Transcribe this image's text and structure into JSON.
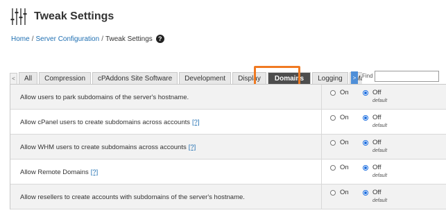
{
  "header": {
    "title": "Tweak Settings",
    "logo_icon": "sliders-icon"
  },
  "breadcrumb": {
    "items": [
      "Home",
      "Server Configuration",
      "Tweak Settings"
    ],
    "separator": "/",
    "help_icon": "question-circle-icon"
  },
  "tabs": {
    "scroll_left": "<",
    "scroll_right": ">",
    "items": [
      {
        "label": "All"
      },
      {
        "label": "Compression"
      },
      {
        "label": "cPAddons Site Software"
      },
      {
        "label": "Development"
      },
      {
        "label": "Display"
      },
      {
        "label": "Domains"
      },
      {
        "label": "Logging"
      },
      {
        "label": "Ma"
      }
    ],
    "active_index": 5,
    "find_label": "Find",
    "find_value": ""
  },
  "settings": {
    "on_label": "On",
    "off_label": "Off",
    "default_label": "default",
    "rows": [
      {
        "label": "Allow users to park subdomains of the server's hostname.",
        "hint": "",
        "selected": "Off"
      },
      {
        "label": "Allow cPanel users to create subdomains across accounts",
        "hint": "[?]",
        "selected": "Off"
      },
      {
        "label": "Allow WHM users to create subdomains across accounts",
        "hint": "[?]",
        "selected": "Off"
      },
      {
        "label": "Allow Remote Domains",
        "hint": "[?]",
        "selected": "Off"
      },
      {
        "label": "Allow resellers to create accounts with subdomains of the server's hostname.",
        "hint": "",
        "selected": "Off"
      }
    ]
  },
  "colors": {
    "accent_highlight": "#f07a22",
    "active_tab": "#4d4d4d",
    "link": "#1f6fb2",
    "radio_checked": "#1e6fe0"
  }
}
